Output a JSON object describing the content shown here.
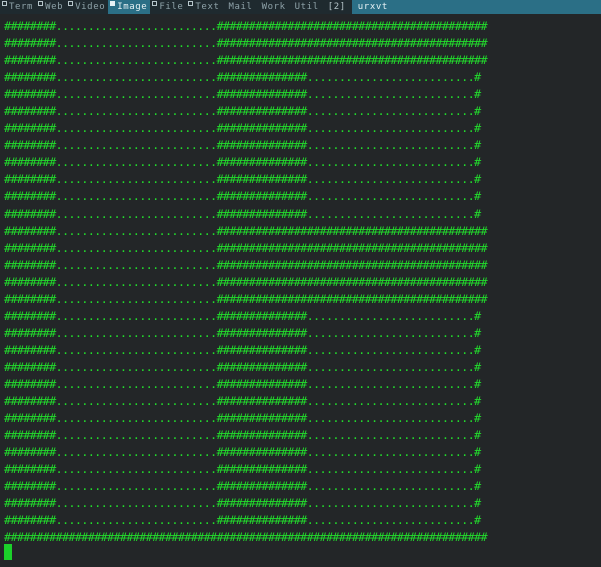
{
  "status_bar": {
    "tags": [
      {
        "label": "Term",
        "name": "tag-term",
        "occupied": true,
        "active": false
      },
      {
        "label": "Web",
        "name": "tag-web",
        "occupied": true,
        "active": false
      },
      {
        "label": "Video",
        "name": "tag-video",
        "occupied": true,
        "active": false
      },
      {
        "label": "Image",
        "name": "tag-image",
        "occupied": true,
        "active": true
      },
      {
        "label": "File",
        "name": "tag-file",
        "occupied": true,
        "active": false
      },
      {
        "label": "Text",
        "name": "tag-text",
        "occupied": true,
        "active": false
      },
      {
        "label": "Mail",
        "name": "tag-mail",
        "occupied": false,
        "active": false
      },
      {
        "label": "Work",
        "name": "tag-work",
        "occupied": false,
        "active": false
      },
      {
        "label": "Util",
        "name": "tag-util",
        "occupied": false,
        "active": false
      }
    ],
    "layout_symbol": "[2]",
    "window_title": "urxvt"
  },
  "terminal": {
    "lines": [
      "########.........................##########################################",
      "########.........................##########################################",
      "########.........................##########################################",
      "########.........................##############..........................#",
      "########.........................##############..........................#",
      "########.........................##############..........................#",
      "########.........................##############..........................#",
      "########.........................##############..........................#",
      "########.........................##############..........................#",
      "########.........................##############..........................#",
      "########.........................##############..........................#",
      "########.........................##############..........................#",
      "########.........................##########################################",
      "########.........................##########################################",
      "########.........................##########################################",
      "########.........................##########################################",
      "########.........................##########################################",
      "########.........................##############..........................#",
      "########.........................##############..........................#",
      "########.........................##############..........................#",
      "########.........................##############..........................#",
      "########.........................##############..........................#",
      "########.........................##############..........................#",
      "########.........................##############..........................#",
      "########.........................##############..........................#",
      "########.........................##############..........................#",
      "########.........................##############..........................#",
      "########.........................##############..........................#",
      "########.........................##############..........................#",
      "########.........................##############..........................#",
      "###########################################################################"
    ],
    "text_color": "#22dd2c",
    "background": "#232628"
  }
}
